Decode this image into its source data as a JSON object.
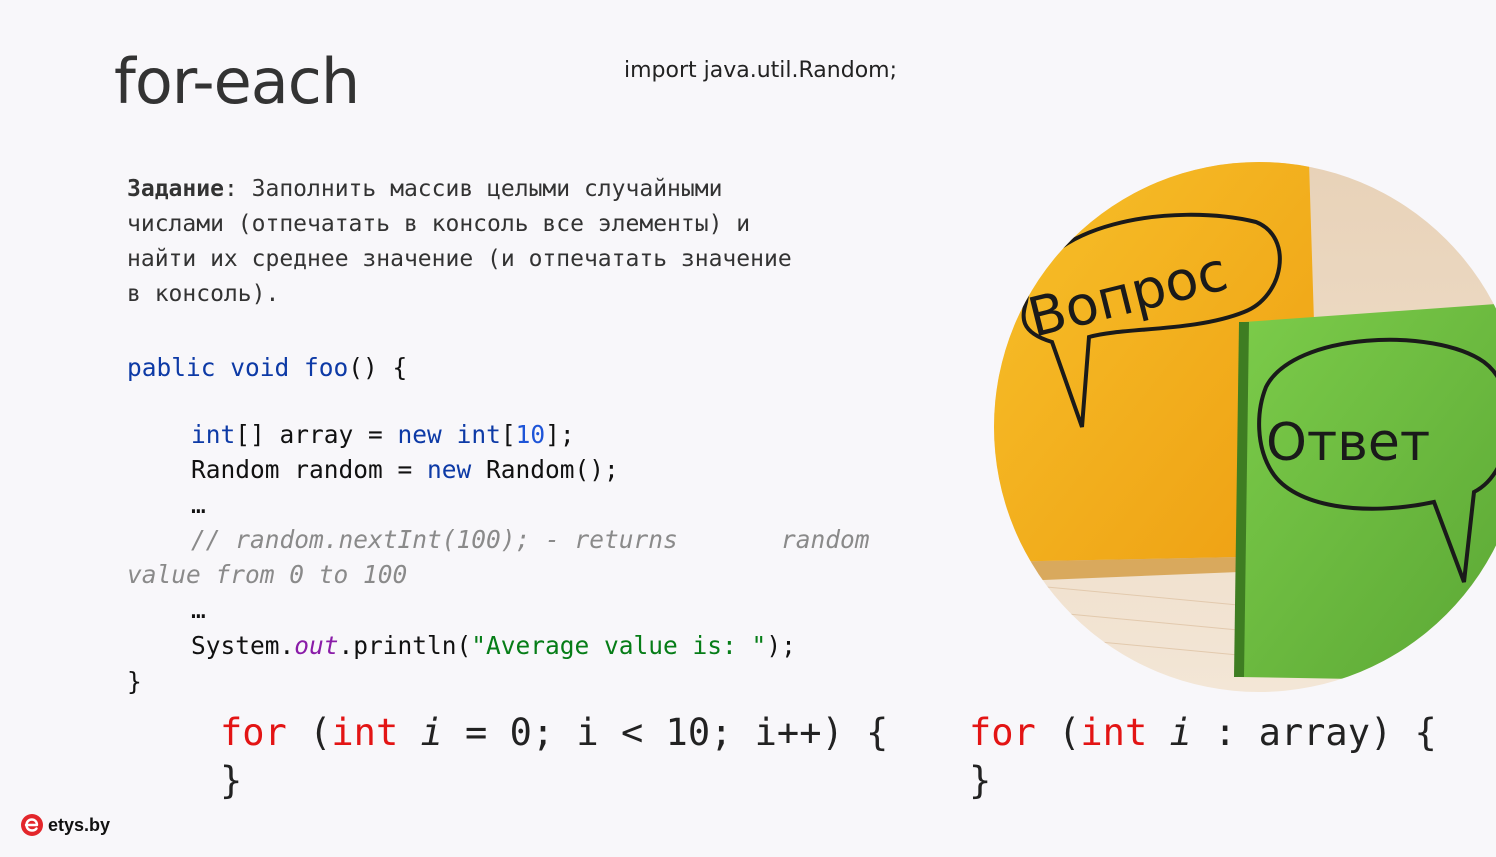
{
  "slide": {
    "title": "for-each",
    "import_line": "import java.util.Random;"
  },
  "task": {
    "label": "Задание",
    "line1_rest": ": Заполнить массив целыми случайными",
    "line2": "числами (отпечатать в консоль все элементы) и",
    "line3": "найти их среднее значение (и отпечатать значение",
    "line4": "в консоль)."
  },
  "code": {
    "sig_kw": "pablic void",
    "sig_name": " foo",
    "sig_rest": "() {",
    "l1_type": "int",
    "l1_mid": "[] array = ",
    "l1_new": "new",
    "l1_sp": " ",
    "l1_type2": "int",
    "l1_open": "[",
    "l1_num": "10",
    "l1_close": "];",
    "l2_pre": "Random random = ",
    "l2_new": "new",
    "l2_post": " Random();",
    "ellipsis1": "…",
    "comment_a": "// random.nextInt(100); - returns       random",
    "comment_b": "value from 0 to 100",
    "ellipsis2": "…",
    "print_pre": "System.",
    "print_field": "out",
    "print_mid": ".println(",
    "print_str": "\"Average value is: \"",
    "print_end": ");",
    "close_brace": "}"
  },
  "loops": {
    "classic_for": "for",
    "classic_open": " (",
    "classic_int": "int",
    "classic_i": " i",
    "classic_rest": " = 0; i < 10; i++) {",
    "classic_close": "}",
    "each_for": "for",
    "each_open": " (",
    "each_int": "int",
    "each_i": " i",
    "each_rest": " : array) {",
    "each_close": "}"
  },
  "image": {
    "note_question": "Вопрос",
    "note_answer": "Ответ"
  },
  "logo": {
    "text": "etys.by"
  },
  "colors": {
    "keyword": "#0d3aa6",
    "loop_keyword": "#e31414",
    "string": "#067d17",
    "comment": "#8a8a8a",
    "note_yellow": "#f5b21c",
    "note_green": "#6bbb3f",
    "logo_red": "#e3262b"
  }
}
